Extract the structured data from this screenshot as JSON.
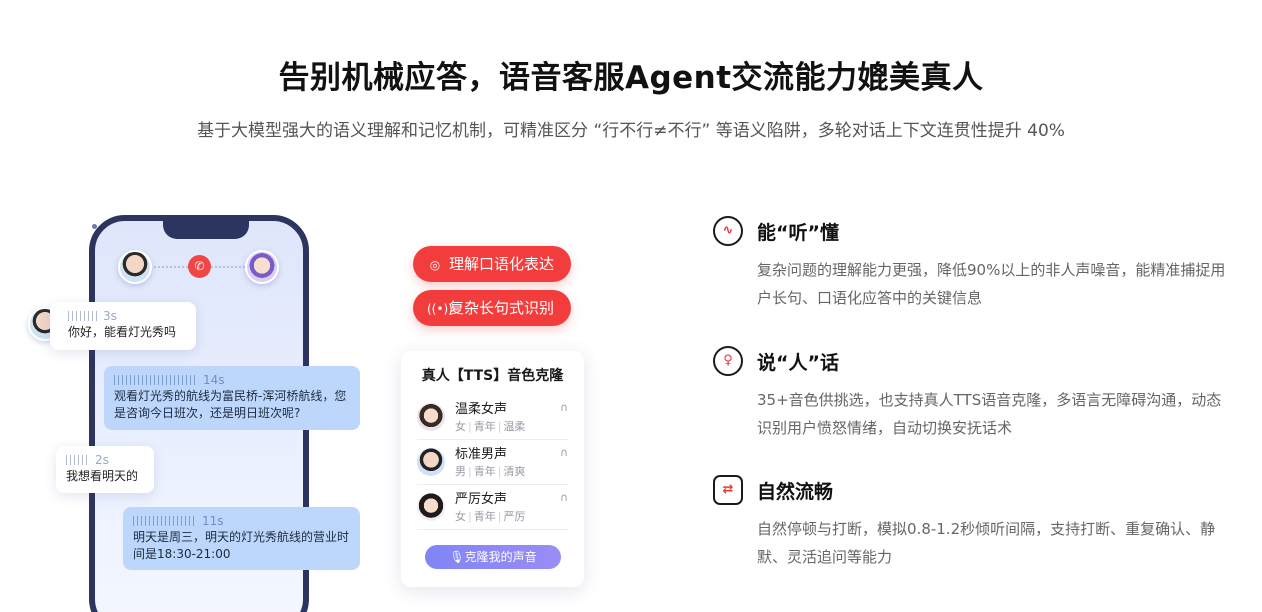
{
  "header": {
    "title": "告别机械应答，语音客服Agent交流能力媲美真人",
    "subtitle": "基于大模型强大的语义理解和记忆机制，可精准区分 “行不行≠不行” 等语义陷阱，多轮对话上下文连贯性提升 40%"
  },
  "phone": {
    "call_icon": "phone-icon",
    "chat": [
      {
        "duration": "3s",
        "text": "你好，能看灯光秀吗"
      },
      {
        "duration": "14s",
        "text": "观看灯光秀的航线为富民桥-浑河桥航线，您是咨询今日班次，还是明日班次呢?"
      },
      {
        "duration": "2s",
        "text": "我想看明天的"
      },
      {
        "duration": "11s",
        "text": "明天是周三，明天的灯光秀航线的营业时间是18:30-21:00"
      }
    ]
  },
  "pills": [
    {
      "label": "理解口语化表达",
      "icon": "speech-icon"
    },
    {
      "label": "复杂长句式识别",
      "icon": "radio-wave-icon"
    }
  ],
  "voice_card": {
    "title": "真人【TTS】音色克隆",
    "voices": [
      {
        "name": "温柔女声",
        "tags": [
          "女",
          "青年",
          "温柔"
        ]
      },
      {
        "name": "标准男声",
        "tags": [
          "男",
          "青年",
          "清爽"
        ]
      },
      {
        "name": "严厉女声",
        "tags": [
          "女",
          "青年",
          "严厉"
        ]
      }
    ],
    "clone_button": "克隆我的声音"
  },
  "features": [
    {
      "title": "能“听”懂",
      "icon": "heartbeat-icon",
      "desc": "复杂问题的理解能力更强，降低90%以上的非人声噪音，能精准捕捉用户长句、口语化应答中的关键信息"
    },
    {
      "title": "说“人”话",
      "icon": "microphone-icon",
      "desc": "35+音色供挑选，也支持真人TTS语音克隆，多语言无障碍沟通，动态识别用户愤怒情绪，自动切换安抚话术"
    },
    {
      "title": "自然流畅",
      "icon": "flow-icon",
      "desc": "自然停顿与打断，模拟0.8-1.2秒倾听间隔，支持打断、重复确认、静默、灵活追问等能力"
    }
  ],
  "colors": {
    "accent": "#f33d3d",
    "bubble_blue": "#bcd7fb",
    "phone_frame": "#2c3560",
    "clone_gradient": "#7f86f5"
  }
}
